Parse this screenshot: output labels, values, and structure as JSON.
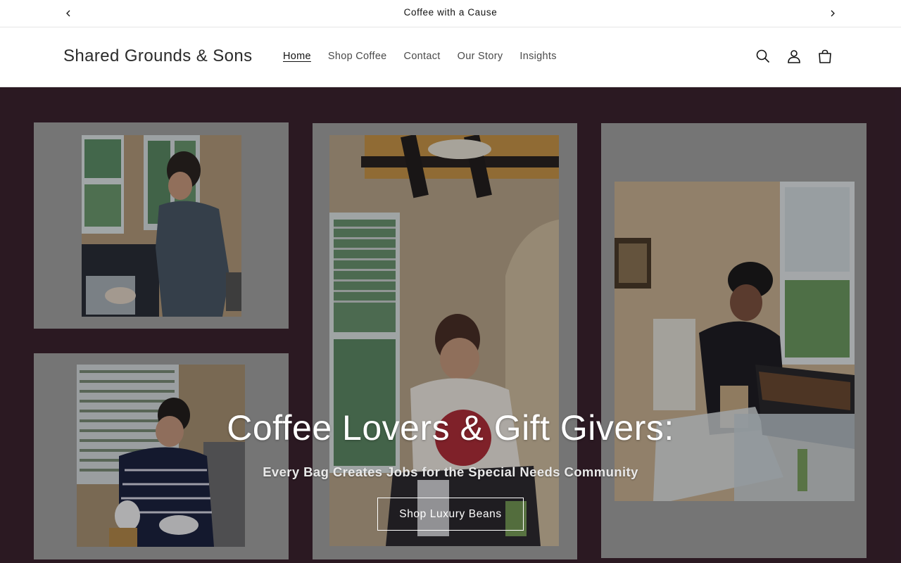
{
  "announcement": {
    "text": "Coffee with a Cause",
    "prev_icon": "chevron-left-icon",
    "next_icon": "chevron-right-icon"
  },
  "header": {
    "logo": "Shared Grounds & Sons",
    "nav": [
      {
        "label": "Home",
        "active": true
      },
      {
        "label": "Shop Coffee",
        "active": false
      },
      {
        "label": "Contact",
        "active": false
      },
      {
        "label": "Our Story",
        "active": false
      },
      {
        "label": "Insights",
        "active": false
      }
    ],
    "icons": [
      "search-icon",
      "account-icon",
      "cart-icon"
    ]
  },
  "hero": {
    "title": "Coffee Lovers & Gift Givers:",
    "subtitle": "Every Bag Creates Jobs for the Special Needs Community",
    "button_label": "Shop Luxury Beans",
    "background_color": "#3c2330",
    "frame_color": "#a3a3a3"
  }
}
